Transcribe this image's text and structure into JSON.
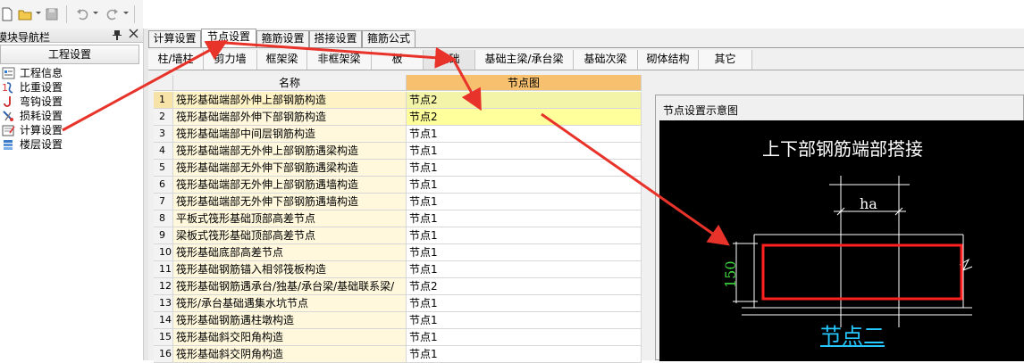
{
  "toolbar": {
    "icons": [
      "new-file-icon",
      "open-folder-icon",
      "save-icon",
      "undo-icon",
      "redo-icon"
    ]
  },
  "sidebar": {
    "title": "模块导航栏",
    "pin_glyph": "📌",
    "close_glyph": "✕",
    "group_title": "工程设置",
    "items": [
      {
        "label": "工程信息",
        "icon": "project-info-icon"
      },
      {
        "label": "比重设置",
        "icon": "weight-ratio-icon"
      },
      {
        "label": "弯钩设置",
        "icon": "hook-icon"
      },
      {
        "label": "损耗设置",
        "icon": "loss-icon"
      },
      {
        "label": "计算设置",
        "icon": "calc-settings-icon"
      },
      {
        "label": "楼层设置",
        "icon": "floor-settings-icon"
      }
    ]
  },
  "top_tabs": [
    {
      "label": "计算设置",
      "active": false
    },
    {
      "label": "节点设置",
      "active": true
    },
    {
      "label": "箍筋设置",
      "active": false
    },
    {
      "label": "搭接设置",
      "active": false
    },
    {
      "label": "箍筋公式",
      "active": false
    }
  ],
  "sub_tabs": [
    {
      "label": "柱/墙柱",
      "active": false
    },
    {
      "label": "剪力墙",
      "active": false
    },
    {
      "label": "框架梁",
      "active": false
    },
    {
      "label": "非框架梁",
      "active": false
    },
    {
      "label": "板",
      "active": false
    },
    {
      "label": "基础",
      "active": true
    },
    {
      "label": "基础主梁/承台梁",
      "active": false
    },
    {
      "label": "基础次梁",
      "active": false
    },
    {
      "label": "砌体结构",
      "active": false
    },
    {
      "label": "其它",
      "active": false
    }
  ],
  "grid": {
    "columns": [
      "",
      "名称",
      "节点图"
    ],
    "rows": [
      {
        "num": "1",
        "name": "筏形基础端部外伸上部钢筋构造",
        "node": "节点2"
      },
      {
        "num": "2",
        "name": "筏形基础端部外伸下部钢筋构造",
        "node": "节点2"
      },
      {
        "num": "3",
        "name": "筏形基础端部中间层钢筋构造",
        "node": "节点1"
      },
      {
        "num": "4",
        "name": "筏形基础端部无外伸上部钢筋遇梁构造",
        "node": "节点1"
      },
      {
        "num": "5",
        "name": "筏形基础端部无外伸下部钢筋遇梁构造",
        "node": "节点1"
      },
      {
        "num": "6",
        "name": "筏形基础端部无外伸上部钢筋遇墙构造",
        "node": "节点1"
      },
      {
        "num": "7",
        "name": "筏形基础端部无外伸下部钢筋遇墙构造",
        "node": "节点1"
      },
      {
        "num": "8",
        "name": "平板式筏形基础顶部高差节点",
        "node": "节点1"
      },
      {
        "num": "9",
        "name": "梁板式筏形基础顶部高差节点",
        "node": "节点1"
      },
      {
        "num": "10",
        "name": "筏形基础底部高差节点",
        "node": "节点1"
      },
      {
        "num": "11",
        "name": "筏形基础钢筋锚入相邻筏板构造",
        "node": "节点1"
      },
      {
        "num": "12",
        "name": "筏形基础钢筋遇承台/独基/承台梁/基础联系梁/",
        "node": "节点2"
      },
      {
        "num": "13",
        "name": "筏形/承台基础遇集水坑节点",
        "node": "节点1"
      },
      {
        "num": "14",
        "name": "筏形基础钢筋遇柱墩构造",
        "node": "节点1"
      },
      {
        "num": "15",
        "name": "筏形基础斜交阳角构造",
        "node": "节点1"
      },
      {
        "num": "16",
        "name": "筏形基础斜交阴角构造",
        "node": "节点1"
      }
    ]
  },
  "preview": {
    "panel_title": "节点设置示意图",
    "diagram_title": "上下部钢筋端部搭接",
    "dim_ha": "ha",
    "dim_150": "150",
    "node_label": "节点二"
  },
  "colors": {
    "annotation_arrow": "#e8332a",
    "diagram_rebar": "#ff2020",
    "diagram_dim_green": "#3ed63e",
    "diagram_label_cyan": "#26c6ff",
    "selected_column_header": "#f6c06e"
  }
}
